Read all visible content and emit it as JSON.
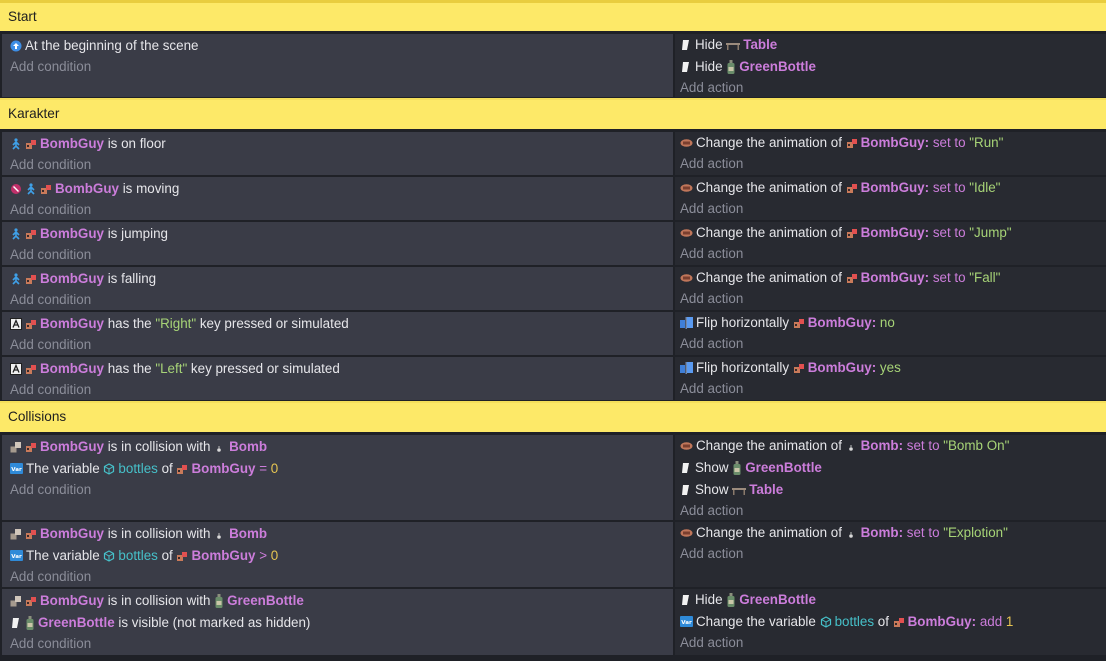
{
  "common": {
    "add_condition": "Add condition",
    "add_action": "Add action"
  },
  "groups": [
    {
      "title": "Start"
    },
    {
      "title": "Karakter"
    },
    {
      "title": "Collisions"
    }
  ],
  "events": [
    {
      "conditions": [
        {
          "icons": [
            "scene-start-icon"
          ],
          "text": "At the beginning of the scene"
        }
      ],
      "actions": [
        {
          "icons": [
            "visibility-icon"
          ],
          "parts": [
            {
              "t": "Hide "
            },
            {
              "ico": "table-icon"
            },
            {
              "obj": "Table"
            }
          ]
        },
        {
          "icons": [
            "visibility-icon"
          ],
          "parts": [
            {
              "t": "Hide "
            },
            {
              "ico": "bottle-icon"
            },
            {
              "obj": "GreenBottle"
            }
          ]
        }
      ]
    },
    {
      "conditions": [
        {
          "icons": [
            "platformer-icon",
            "bombguy-icon"
          ],
          "parts": [
            {
              "obj": "BombGuy"
            },
            {
              "t": " is on floor"
            }
          ]
        }
      ],
      "actions": [
        {
          "icons": [
            "animation-icon"
          ],
          "parts": [
            {
              "t": "Change the animation of "
            },
            {
              "ico": "bombguy-icon"
            },
            {
              "obj": "BombGuy"
            },
            {
              "obj": ":"
            },
            {
              "kw": " set to "
            },
            {
              "str": "\"Run\""
            }
          ]
        }
      ]
    },
    {
      "conditions": [
        {
          "icons": [
            "invert-icon",
            "platformer-icon",
            "bombguy-icon"
          ],
          "parts": [
            {
              "obj": "BombGuy"
            },
            {
              "t": " is moving"
            }
          ]
        }
      ],
      "actions": [
        {
          "icons": [
            "animation-icon"
          ],
          "parts": [
            {
              "t": "Change the animation of "
            },
            {
              "ico": "bombguy-icon"
            },
            {
              "obj": "BombGuy"
            },
            {
              "obj": ":"
            },
            {
              "kw": " set to "
            },
            {
              "str": "\"Idle\""
            }
          ]
        }
      ]
    },
    {
      "conditions": [
        {
          "icons": [
            "platformer-icon",
            "bombguy-icon"
          ],
          "parts": [
            {
              "obj": "BombGuy"
            },
            {
              "t": " is jumping"
            }
          ]
        }
      ],
      "actions": [
        {
          "icons": [
            "animation-icon"
          ],
          "parts": [
            {
              "t": "Change the animation of "
            },
            {
              "ico": "bombguy-icon"
            },
            {
              "obj": "BombGuy"
            },
            {
              "obj": ":"
            },
            {
              "kw": " set to "
            },
            {
              "str": "\"Jump\""
            }
          ]
        }
      ]
    },
    {
      "conditions": [
        {
          "icons": [
            "platformer-icon",
            "bombguy-icon"
          ],
          "parts": [
            {
              "obj": "BombGuy"
            },
            {
              "t": " is falling"
            }
          ]
        }
      ],
      "actions": [
        {
          "icons": [
            "animation-icon"
          ],
          "parts": [
            {
              "t": "Change the animation of "
            },
            {
              "ico": "bombguy-icon"
            },
            {
              "obj": "BombGuy"
            },
            {
              "obj": ":"
            },
            {
              "kw": " set to "
            },
            {
              "str": "\"Fall\""
            }
          ]
        }
      ]
    },
    {
      "conditions": [
        {
          "icons": [
            "keyboard-icon",
            "bombguy-icon"
          ],
          "parts": [
            {
              "obj": "BombGuy"
            },
            {
              "t": " has the "
            },
            {
              "str": "\"Right\""
            },
            {
              "t": " key pressed or simulated"
            }
          ]
        }
      ],
      "actions": [
        {
          "icons": [
            "flip-icon"
          ],
          "parts": [
            {
              "t": "Flip horizontally "
            },
            {
              "ico": "bombguy-icon"
            },
            {
              "obj": "BombGuy"
            },
            {
              "obj": ":"
            },
            {
              "str": " no"
            }
          ]
        }
      ]
    },
    {
      "conditions": [
        {
          "icons": [
            "keyboard-icon",
            "bombguy-icon"
          ],
          "parts": [
            {
              "obj": "BombGuy"
            },
            {
              "t": " has the "
            },
            {
              "str": "\"Left\""
            },
            {
              "t": " key pressed or simulated"
            }
          ]
        }
      ],
      "actions": [
        {
          "icons": [
            "flip-icon"
          ],
          "parts": [
            {
              "t": "Flip horizontally "
            },
            {
              "ico": "bombguy-icon"
            },
            {
              "obj": "BombGuy"
            },
            {
              "obj": ":"
            },
            {
              "str": " yes"
            }
          ]
        }
      ]
    },
    {
      "conditions": [
        {
          "icons": [
            "collision-icon",
            "bombguy-icon"
          ],
          "parts": [
            {
              "obj": "BombGuy"
            },
            {
              "t": " is in collision with "
            },
            {
              "ico": "bomb-icon"
            },
            {
              "obj": "Bomb"
            }
          ]
        },
        {
          "icons": [
            "variable-icon"
          ],
          "parts": [
            {
              "t": "The variable "
            },
            {
              "ico": "var-cube-icon"
            },
            {
              "var": "bottles"
            },
            {
              "t": " of "
            },
            {
              "ico": "bombguy-icon"
            },
            {
              "obj": "BombGuy"
            },
            {
              "kw": " = "
            },
            {
              "num": "0"
            }
          ]
        }
      ],
      "actions": [
        {
          "icons": [
            "animation-icon"
          ],
          "parts": [
            {
              "t": "Change the animation of "
            },
            {
              "ico": "bomb-icon"
            },
            {
              "obj": "Bomb"
            },
            {
              "obj": ":"
            },
            {
              "kw": " set to "
            },
            {
              "str": "\"Bomb On\""
            }
          ]
        },
        {
          "icons": [
            "visibility-icon"
          ],
          "parts": [
            {
              "t": "Show "
            },
            {
              "ico": "bottle-icon"
            },
            {
              "obj": "GreenBottle"
            }
          ]
        },
        {
          "icons": [
            "visibility-icon"
          ],
          "parts": [
            {
              "t": "Show "
            },
            {
              "ico": "table-icon"
            },
            {
              "obj": "Table"
            }
          ]
        }
      ]
    },
    {
      "conditions": [
        {
          "icons": [
            "collision-icon",
            "bombguy-icon"
          ],
          "parts": [
            {
              "obj": "BombGuy"
            },
            {
              "t": " is in collision with "
            },
            {
              "ico": "bomb-icon"
            },
            {
              "obj": "Bomb"
            }
          ]
        },
        {
          "icons": [
            "variable-icon"
          ],
          "parts": [
            {
              "t": "The variable "
            },
            {
              "ico": "var-cube-icon"
            },
            {
              "var": "bottles"
            },
            {
              "t": " of "
            },
            {
              "ico": "bombguy-icon"
            },
            {
              "obj": "BombGuy"
            },
            {
              "kw": " > "
            },
            {
              "num": "0"
            }
          ]
        }
      ],
      "actions": [
        {
          "icons": [
            "animation-icon"
          ],
          "parts": [
            {
              "t": "Change the animation of "
            },
            {
              "ico": "bomb-icon"
            },
            {
              "obj": "Bomb"
            },
            {
              "obj": ":"
            },
            {
              "kw": " set to "
            },
            {
              "str": "\"Explotion\""
            }
          ]
        }
      ]
    },
    {
      "conditions": [
        {
          "icons": [
            "collision-icon",
            "bombguy-icon"
          ],
          "parts": [
            {
              "obj": "BombGuy"
            },
            {
              "t": " is in collision with "
            },
            {
              "ico": "bottle-icon"
            },
            {
              "obj": "GreenBottle"
            }
          ]
        },
        {
          "icons": [
            "visibility-icon",
            "bottle-icon"
          ],
          "parts": [
            {
              "obj": "GreenBottle"
            },
            {
              "t": " is visible (not marked as hidden)"
            }
          ]
        }
      ],
      "actions": [
        {
          "icons": [
            "visibility-icon"
          ],
          "parts": [
            {
              "t": "Hide "
            },
            {
              "ico": "bottle-icon"
            },
            {
              "obj": "GreenBottle"
            }
          ]
        },
        {
          "icons": [
            "variable-icon"
          ],
          "parts": [
            {
              "t": "Change the variable "
            },
            {
              "ico": "var-cube-icon"
            },
            {
              "var": "bottles"
            },
            {
              "t": " of "
            },
            {
              "ico": "bombguy-icon"
            },
            {
              "obj": "BombGuy"
            },
            {
              "obj": ":"
            },
            {
              "kw": " add "
            },
            {
              "num": "1"
            }
          ]
        }
      ]
    }
  ]
}
